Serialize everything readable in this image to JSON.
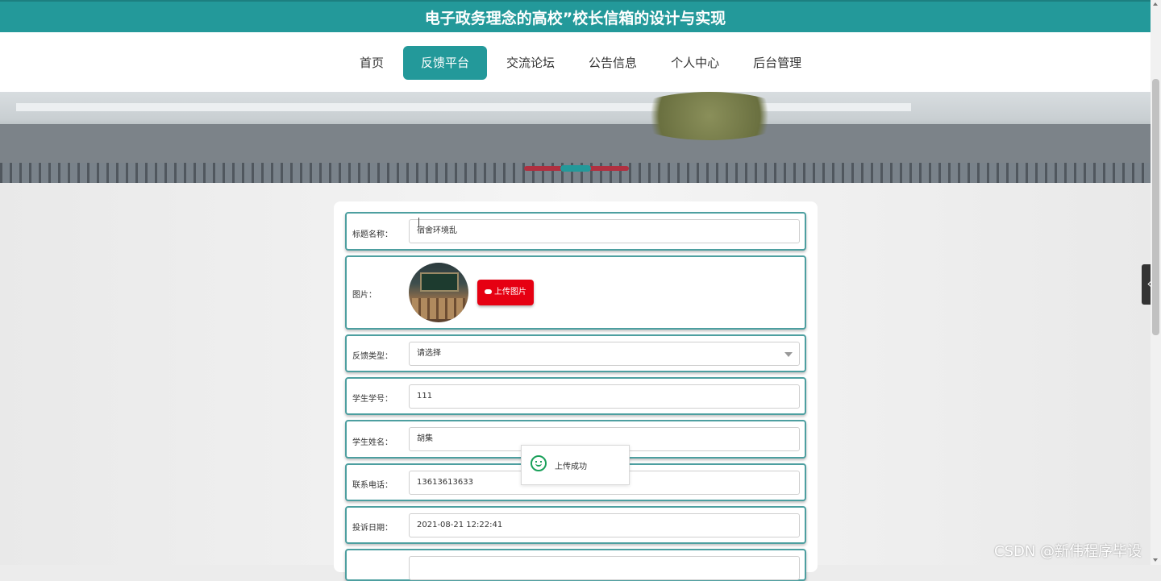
{
  "header": {
    "title": "电子政务理念的高校”校长信箱的设计与实现"
  },
  "nav": {
    "items": [
      {
        "label": "首页"
      },
      {
        "label": "反馈平台"
      },
      {
        "label": "交流论坛"
      },
      {
        "label": "公告信息"
      },
      {
        "label": "个人中心"
      },
      {
        "label": "后台管理"
      }
    ]
  },
  "form": {
    "title_label": "标题名称：",
    "title_value": "宿舍环境乱",
    "image_label": "图片：",
    "upload_label": "上传图片",
    "type_label": "反馈类型：",
    "type_placeholder": "请选择",
    "student_no_label": "学生学号：",
    "student_no_value": "111",
    "student_name_label": "学生姓名：",
    "student_name_value": "胡集",
    "phone_label": "联系电话：",
    "phone_value": "13613613633",
    "date_label": "投诉日期：",
    "date_value": "2021-08-21 12:22:41"
  },
  "toast": {
    "message": "上传成功"
  },
  "watermark": "CSDN @新伟程序毕设",
  "colors": {
    "primary": "#23999a",
    "upload": "#e60012",
    "success": "#1aa05a"
  }
}
